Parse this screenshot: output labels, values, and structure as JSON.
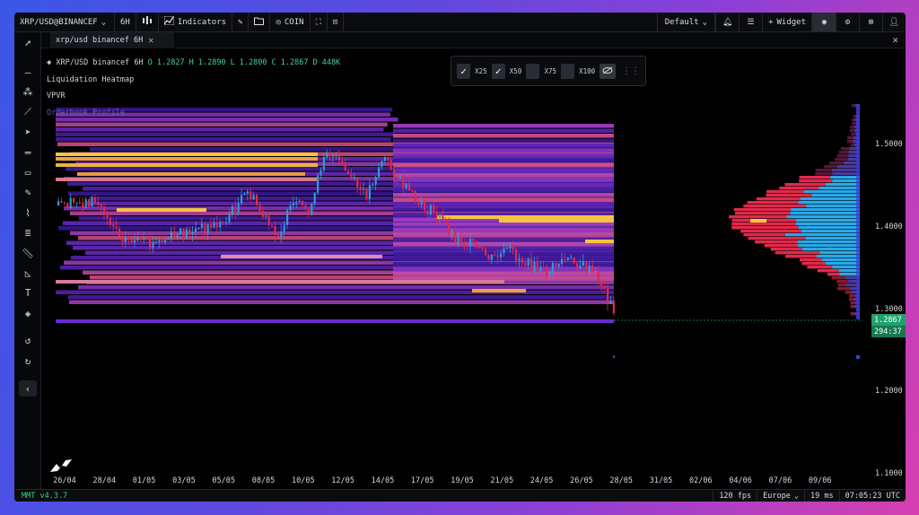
{
  "topbar": {
    "symbol": "XRP/USD@BINANCEF",
    "timeframe": "6H",
    "indicators_label": "Indicators",
    "coin_label": "COIN",
    "layout_label": "Default",
    "widget_label": "Widget"
  },
  "tab": {
    "label": "xrp/usd binancef 6H"
  },
  "legend": {
    "symbol": "XRP/USD binancef 6H",
    "open": "O 1.2827",
    "high": "H 1.2890",
    "low": "L 1.2800",
    "close": "C 1.2867",
    "delta": "D 448K",
    "indicators": [
      "Liquidation Heatmap",
      "VPVR",
      "Orderbook Profile"
    ]
  },
  "leverage": {
    "options": [
      {
        "label": "X25",
        "checked": true
      },
      {
        "label": "X50",
        "checked": true
      },
      {
        "label": "X75",
        "checked": false
      },
      {
        "label": "X100",
        "checked": false
      }
    ]
  },
  "price_axis": {
    "ticks": [
      "1.5000",
      "1.4000",
      "1.3000",
      "1.2000",
      "1.1000"
    ],
    "last_price": "1.2867",
    "countdown": "294:37",
    "accent": "#1fa36b"
  },
  "time_axis": [
    "26/04",
    "28/04",
    "01/05",
    "03/05",
    "05/05",
    "08/05",
    "10/05",
    "12/05",
    "14/05",
    "17/05",
    "19/05",
    "21/05",
    "24/05",
    "26/05",
    "28/05",
    "31/05",
    "02/06",
    "04/06",
    "07/06",
    "09/06"
  ],
  "status": {
    "version": "MMT v4.3.7",
    "fps": "120 fps",
    "region": "Europe",
    "latency": "19 ms",
    "clock": "07:05:23 UTC"
  },
  "colors": {
    "up": "#2e9bd8",
    "down": "#e2294a",
    "heat_low": "#4a1fa8",
    "heat_mid": "#b03fc8",
    "heat_high": "#f5c542"
  }
}
